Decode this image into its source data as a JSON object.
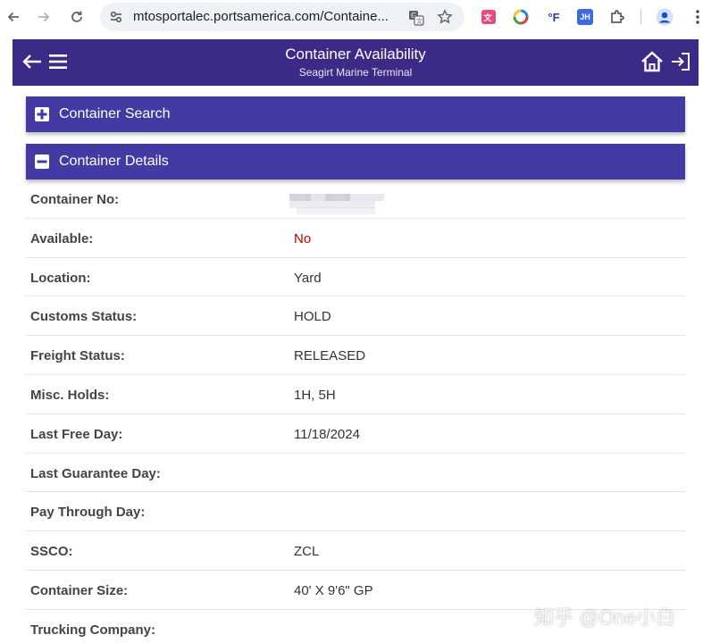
{
  "browser": {
    "url": "mtosportalec.portsamerica.com/Containe...",
    "ext_f_label": "°F",
    "ext_jh_label": "JH"
  },
  "header": {
    "title": "Container Availability",
    "subtitle": "Seagirt Marine Terminal",
    "color": "#3b2a86"
  },
  "panels": {
    "search_label": "Container Search",
    "details_label": "Container Details",
    "color": "#433ba3"
  },
  "details": {
    "rows": [
      {
        "label": "Container No:",
        "value": ""
      },
      {
        "label": "Available:",
        "value": "No"
      },
      {
        "label": "Location:",
        "value": "Yard"
      },
      {
        "label": "Customs Status:",
        "value": "HOLD"
      },
      {
        "label": "Freight Status:",
        "value": "RELEASED"
      },
      {
        "label": "Misc. Holds:",
        "value": "1H, 5H"
      },
      {
        "label": "Last Free Day:",
        "value": "11/18/2024"
      },
      {
        "label": "Last Guarantee Day:",
        "value": ""
      },
      {
        "label": "Pay Through Day:",
        "value": ""
      },
      {
        "label": "SSCO:",
        "value": "ZCL"
      },
      {
        "label": "Container Size:",
        "value": "40' X 9'6\" GP"
      },
      {
        "label": "Trucking Company:",
        "value": ""
      }
    ]
  },
  "watermark": "知乎 @One小白"
}
